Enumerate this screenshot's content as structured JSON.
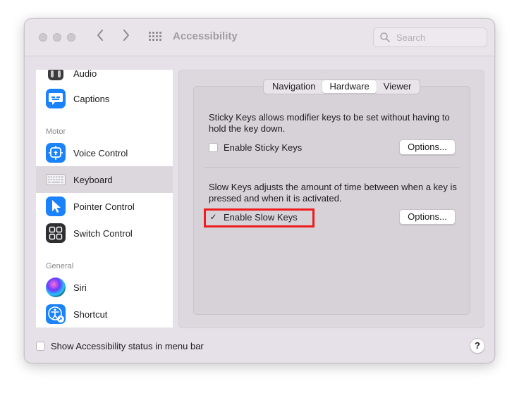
{
  "window": {
    "title": "Accessibility"
  },
  "toolbar": {
    "back_icon": "chevron-left-icon",
    "forward_icon": "chevron-right-icon",
    "grid_icon": "grid-icon",
    "search_placeholder": "Search"
  },
  "sidebar": {
    "items_top": [
      {
        "label": "Audio",
        "icon": "audio-icon"
      },
      {
        "label": "Captions",
        "icon": "captions-icon"
      }
    ],
    "section_motor": "Motor",
    "items_motor": [
      {
        "label": "Voice Control",
        "icon": "voice-control-icon"
      },
      {
        "label": "Keyboard",
        "icon": "keyboard-icon",
        "selected": true
      },
      {
        "label": "Pointer Control",
        "icon": "pointer-icon"
      },
      {
        "label": "Switch Control",
        "icon": "switch-control-icon"
      }
    ],
    "section_general": "General",
    "items_general": [
      {
        "label": "Siri",
        "icon": "siri-icon"
      },
      {
        "label": "Shortcut",
        "icon": "shortcut-icon"
      }
    ]
  },
  "tabs": [
    {
      "label": "Navigation",
      "active": false
    },
    {
      "label": "Hardware",
      "active": true
    },
    {
      "label": "Viewer",
      "active": false
    }
  ],
  "sticky_keys": {
    "description": "Sticky Keys allows modifier keys to be set without having to hold the key down.",
    "checkbox_label": "Enable Sticky Keys",
    "checked": false,
    "options_label": "Options..."
  },
  "slow_keys": {
    "description": "Slow Keys adjusts the amount of time between when a key is pressed and when it is activated.",
    "checkbox_label": "Enable Slow Keys",
    "checked": true,
    "check_glyph": "✓",
    "options_label": "Options..."
  },
  "footer": {
    "status_checkbox_label": "Show Accessibility status in menu bar",
    "status_checked": false,
    "help_label": "?"
  },
  "colors": {
    "highlight": "#ee1c1c",
    "captions_blue": "#1a82fb",
    "selected_row": "#dcd7dd"
  }
}
